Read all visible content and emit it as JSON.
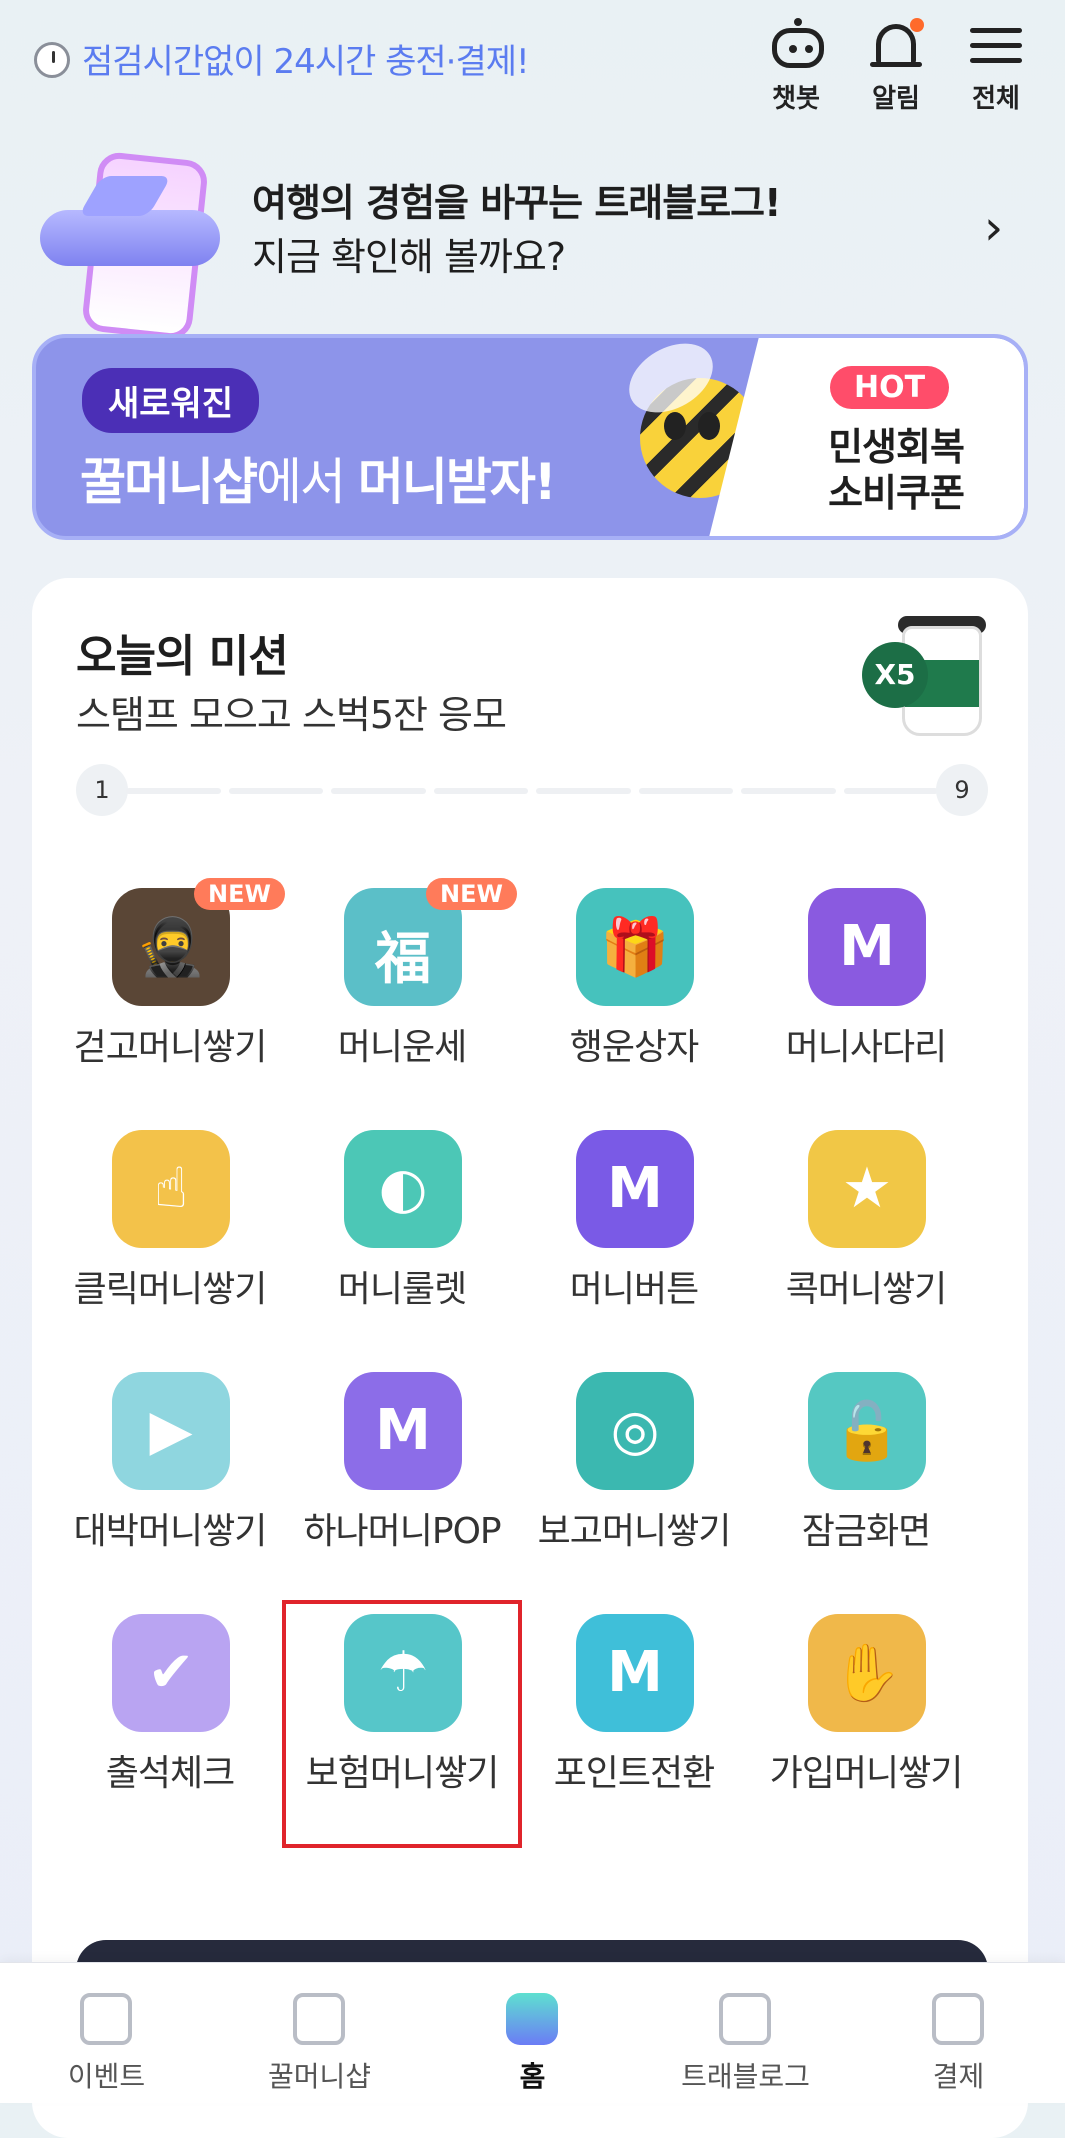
{
  "topbar": {
    "notice": "점검시간없이 24시간 충전·결제!",
    "chatbot_label": "챗봇",
    "alarm_label": "알림",
    "menu_label": "전체"
  },
  "promo": {
    "line1": "여행의 경험을 바꾸는 트래블로그!",
    "line2": "지금 확인해 볼까요?"
  },
  "banner": {
    "pill": "새로워진",
    "main_bold": "꿀머니샵",
    "main_thin": "에서 ",
    "main_bold2": "머니받자!",
    "hot": "HOT",
    "hot_text": "민생회복 소비쿠폰"
  },
  "mission": {
    "title": "오늘의 미션",
    "subtitle": "스탬프 모으고 스벅5잔 응모",
    "badge": "X5",
    "progress_start": "1",
    "progress_end": "9",
    "progress_current": 1,
    "progress_total": 9
  },
  "items": [
    {
      "label": "걷고머니쌓기",
      "badge": "NEW",
      "icon": "thief-walking-icon",
      "color": "#5a4636"
    },
    {
      "label": "머니운세",
      "badge": "NEW",
      "icon": "fortune-scroll-icon",
      "color": "#5bbfc8"
    },
    {
      "label": "행운상자",
      "badge": "",
      "icon": "gift-box-icon",
      "color": "#46c2bd"
    },
    {
      "label": "머니사다리",
      "badge": "",
      "icon": "money-bag-ladder-icon",
      "color": "#8a5ae0"
    },
    {
      "label": "클릭머니쌓기",
      "badge": "",
      "icon": "tap-coins-icon",
      "color": "#f3c24a"
    },
    {
      "label": "머니룰렛",
      "badge": "",
      "icon": "roulette-icon",
      "color": "#4cc7b6"
    },
    {
      "label": "머니버튼",
      "badge": "",
      "icon": "money-button-icon",
      "color": "#7a5ae6"
    },
    {
      "label": "콕머니쌓기",
      "badge": "",
      "icon": "poke-coin-icon",
      "color": "#f1c746"
    },
    {
      "label": "대박머니쌓기",
      "badge": "",
      "icon": "video-play-icon",
      "color": "#8fd6df"
    },
    {
      "label": "하나머니POP",
      "badge": "",
      "icon": "m-coin-pop-icon",
      "color": "#8c6de8"
    },
    {
      "label": "보고머니쌓기",
      "badge": "",
      "icon": "binoculars-icon",
      "color": "#3bb8b0"
    },
    {
      "label": "잠금화면",
      "badge": "",
      "icon": "padlock-key-icon",
      "color": "#55c8c2"
    },
    {
      "label": "출석체크",
      "badge": "",
      "icon": "calendar-check-icon",
      "color": "#b9a4f2"
    },
    {
      "label": "보험머니쌓기",
      "badge": "",
      "icon": "car-umbrella-icon",
      "color": "#56c6c9"
    },
    {
      "label": "포인트전환",
      "badge": "",
      "icon": "m-exchange-icon",
      "color": "#3fbfd9"
    },
    {
      "label": "가입머니쌓기",
      "badge": "",
      "icon": "coin-hand-icon",
      "color": "#f0b84a"
    }
  ],
  "tabbar": {
    "tabs": [
      {
        "label": "이벤트",
        "icon": "gift-icon"
      },
      {
        "label": "꿀머니샵",
        "icon": "m-hexagon-icon"
      },
      {
        "label": "홈",
        "icon": "home-icon"
      },
      {
        "label": "트래블로그",
        "icon": "plane-ticket-icon"
      },
      {
        "label": "결제",
        "icon": "barcode-scan-icon"
      }
    ],
    "active": "홈"
  }
}
